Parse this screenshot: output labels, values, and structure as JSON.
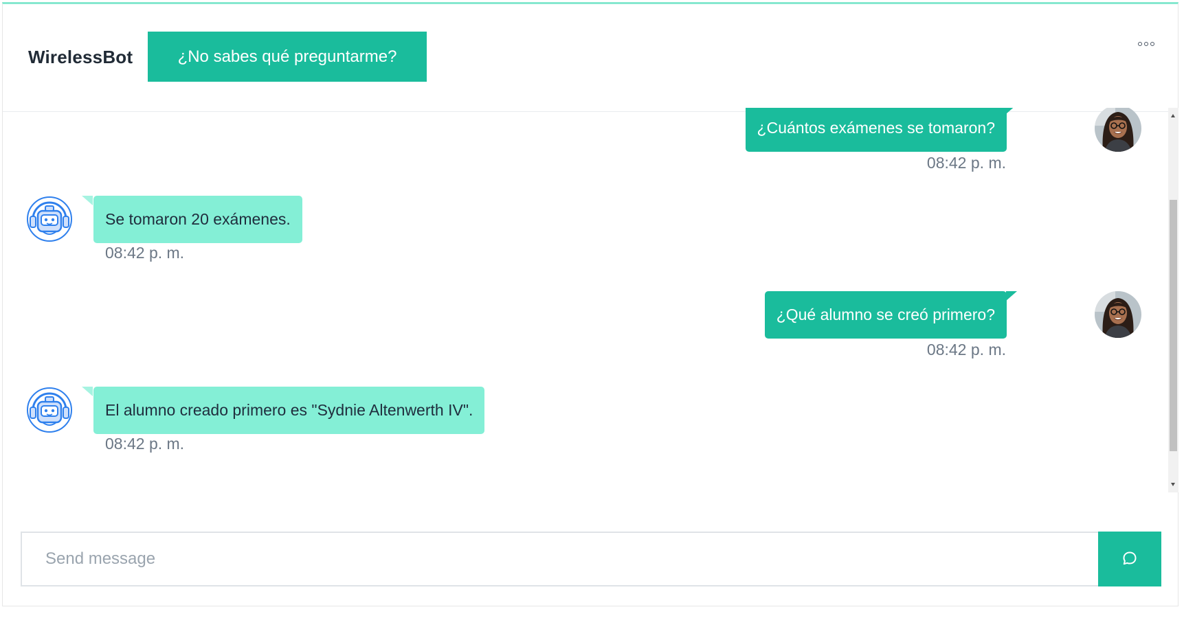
{
  "header": {
    "brand": "WirelessBot",
    "help_button": "¿No sabes qué preguntarme?",
    "more_icon": "more-horizontal-icon"
  },
  "messages": [
    {
      "sender": "user",
      "text": "¿Cuántos exámenes se tomaron?",
      "time": "08:42 p. m."
    },
    {
      "sender": "bot",
      "text": "Se tomaron 20 exámenes.",
      "time": "08:42 p. m."
    },
    {
      "sender": "user",
      "text": "¿Qué alumno se creó primero?",
      "time": "08:42 p. m."
    },
    {
      "sender": "bot",
      "text": "El alumno creado primero es \"Sydnie Altenwerth IV\".",
      "time": "08:42 p. m."
    }
  ],
  "composer": {
    "placeholder": "Send message",
    "send_icon": "chat-bubble-icon"
  },
  "colors": {
    "accent": "#1abc9c",
    "bot_bubble": "#84efd6",
    "top_border": "#86e8cf",
    "bot_icon": "#2f80ed"
  }
}
